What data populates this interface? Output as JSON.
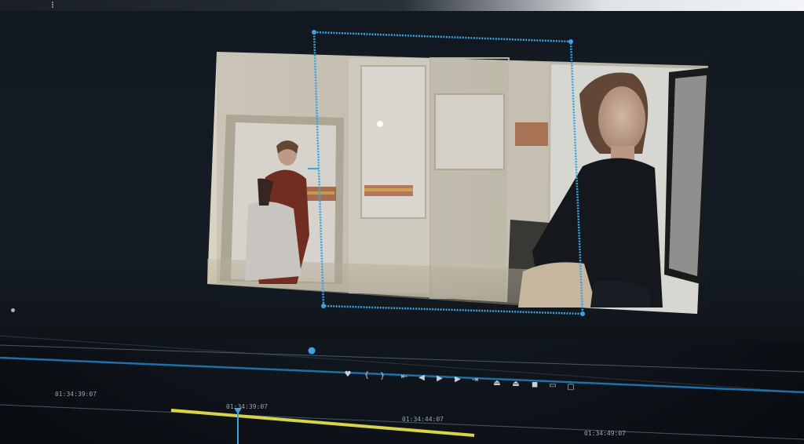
{
  "panel": {
    "title": "",
    "menu_icon": "panel-menu-icon"
  },
  "transport": {
    "buttons": [
      {
        "name": "add-marker-button",
        "glyph": "♥"
      },
      {
        "name": "mark-in-button",
        "glyph": "{"
      },
      {
        "name": "mark-out-button",
        "glyph": "}"
      },
      {
        "name": "go-to-in-button",
        "glyph": "⇤"
      },
      {
        "name": "step-back-button",
        "glyph": "◀"
      },
      {
        "name": "play-button",
        "glyph": "▶"
      },
      {
        "name": "step-forward-button",
        "glyph": "▶"
      },
      {
        "name": "go-to-out-button",
        "glyph": "⇥"
      },
      {
        "name": "lift-button",
        "glyph": "⏏"
      },
      {
        "name": "extract-button",
        "glyph": "⏏"
      },
      {
        "name": "export-frame-button",
        "glyph": "◼"
      },
      {
        "name": "insert-button",
        "glyph": "▭"
      },
      {
        "name": "overwrite-button",
        "glyph": "▢"
      }
    ]
  },
  "timeline": {
    "timecodes": [
      "01:34:39:07",
      "01:34:39:07",
      "01:34:44:07",
      "01:34:49:07"
    ]
  },
  "colors": {
    "accent": "#3aa3e0",
    "in_out_range": "#d8d44a"
  }
}
